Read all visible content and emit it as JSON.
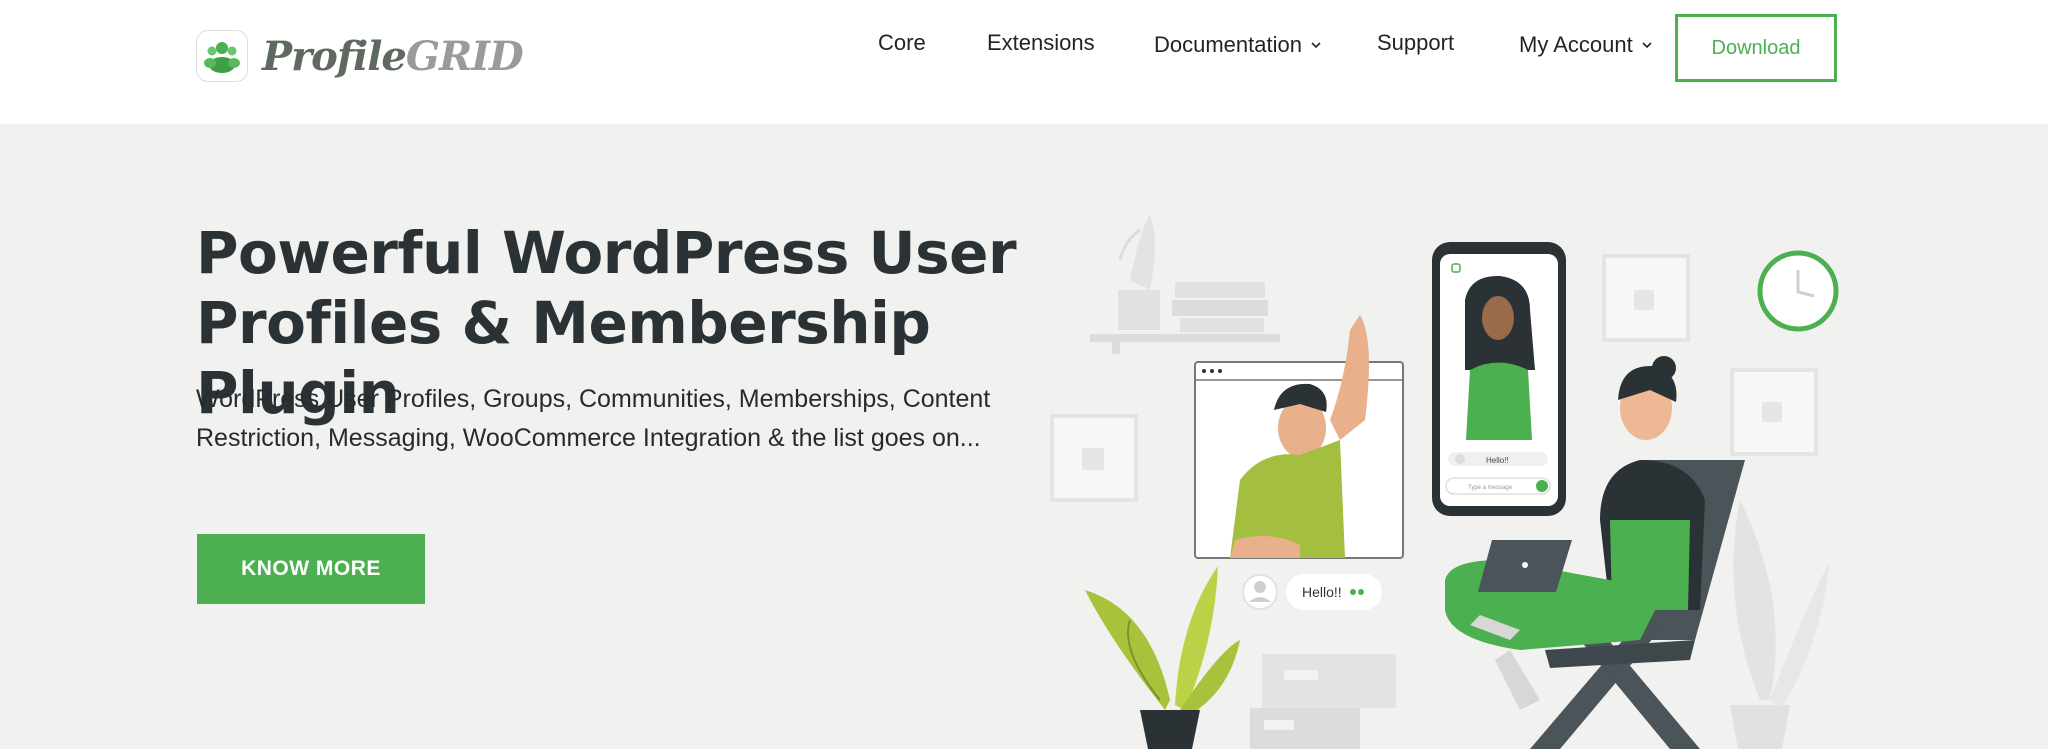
{
  "brand": {
    "name_part1": "Profile",
    "name_part2": "GRID",
    "accent": "#4caf50"
  },
  "nav": {
    "items": [
      {
        "label": "Core"
      },
      {
        "label": "Extensions"
      },
      {
        "label": "Documentation"
      },
      {
        "label": "Support"
      },
      {
        "label": "My Account"
      }
    ],
    "download_label": "Download"
  },
  "hero": {
    "title_line1": "Powerful WordPress User",
    "title_line2": "Profiles & Membership Plugin",
    "subtitle_line1": "WordPress User Profiles, Groups, Communities, Memberships, Content",
    "subtitle_line2": "Restriction, Messaging, WooCommerce Integration & the list goes on...",
    "cta_label": "KNOW MORE"
  },
  "illustration": {
    "chat_bubble_text": "Hello!!",
    "phone_bubble_text": "Hello!!",
    "phone_input_placeholder": "Type a message"
  }
}
